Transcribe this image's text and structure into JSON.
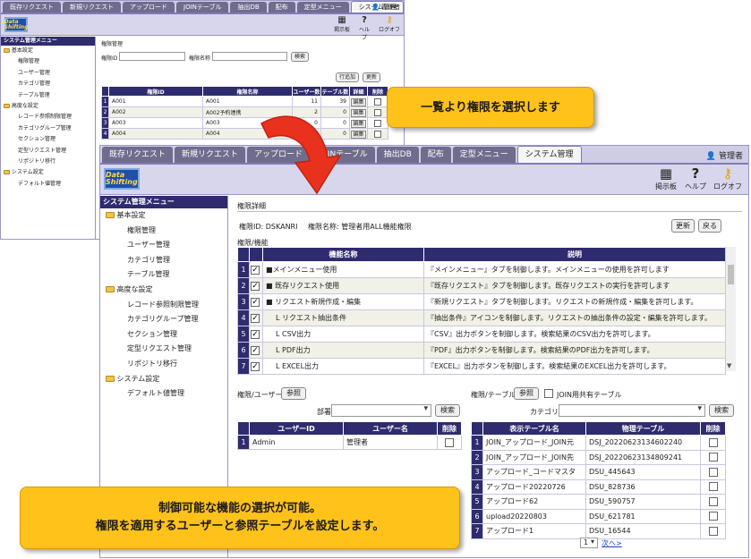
{
  "back": {
    "tabs": [
      "既存リクエスト",
      "新規リクエスト",
      "アップロード",
      "JOINテーブル",
      "抽出DB",
      "配布",
      "定型メニュー",
      "システム管理"
    ],
    "user": "管理者",
    "toolbar": {
      "board": "掲示板",
      "help": "ヘルプ",
      "logout": "ログオフ",
      "logo": "Data Shifting"
    },
    "sidebar": {
      "title": "システム管理メニュー",
      "g1": "基本設定",
      "g1_items": [
        "権限管理",
        "ユーザー管理",
        "カテゴリ管理",
        "テーブル管理"
      ],
      "g2": "高度な設定",
      "g2_items": [
        "レコード参照制限管理",
        "カテゴリグループ管理",
        "セクション管理",
        "定型リクエスト管理",
        "リポジトリ移行"
      ],
      "g3": "システム設定",
      "g3_items": [
        "デフォルト値管理"
      ]
    },
    "page_title": "権限管理",
    "search_id_label": "権限ID",
    "search_name_label": "権限名称",
    "search_btn": "検索",
    "add_btn": "行追加",
    "update_btn": "更新",
    "columns": [
      "権限ID",
      "権限名称",
      "ユーザー数",
      "テーブル数",
      "詳細",
      "削除"
    ],
    "rows": [
      {
        "n": "1",
        "id": "A001",
        "name": "A001",
        "users": "11",
        "tables": "39",
        "detail": "編集"
      },
      {
        "n": "2",
        "id": "A002",
        "name": "A002予約連携",
        "users": "2",
        "tables": "0",
        "detail": "編集"
      },
      {
        "n": "3",
        "id": "A003",
        "name": "A003",
        "users": "0",
        "tables": "0",
        "detail": "編集"
      },
      {
        "n": "4",
        "id": "A004",
        "name": "A004",
        "users": "0",
        "tables": "0",
        "detail": "編集"
      }
    ]
  },
  "front": {
    "tabs": [
      "既存リクエスト",
      "新規リクエスト",
      "アップロード",
      "JOINテーブル",
      "抽出DB",
      "配布",
      "定型メニュー",
      "システム管理"
    ],
    "user": "管理者",
    "toolbar": {
      "board": "掲示板",
      "help": "ヘルプ",
      "logout": "ログオフ",
      "logo": "Data Shifting"
    },
    "sidebar": {
      "title": "システム管理メニュー",
      "g1": "基本設定",
      "g1_items": [
        "権限管理",
        "ユーザー管理",
        "カテゴリ管理",
        "テーブル管理"
      ],
      "g2": "高度な設定",
      "g2_items": [
        "レコード参照制限管理",
        "カテゴリグループ管理",
        "セクション管理",
        "定型リクエスト管理",
        "リポジトリ移行"
      ],
      "g3": "システム設定",
      "g3_items": [
        "デフォルト値管理"
      ]
    },
    "page_title": "権限詳細",
    "id_line": "権限ID: DSKANRI",
    "name_line": "権限名称: 管理者用ALL機能権限",
    "update_btn": "更新",
    "back_btn": "戻る",
    "func_section": "権限/機能",
    "func_columns": [
      "機能名称",
      "説明"
    ],
    "func_rows": [
      {
        "n": "1",
        "name": "■メインメニュー使用",
        "desc": "『メインメニュー』タブを制御します。メインメニューの使用を許可します"
      },
      {
        "n": "2",
        "name": "■ 既存リクエスト使用",
        "desc": "『既存リクエスト』タブを制御します。既存リクエストの実行を許可します"
      },
      {
        "n": "3",
        "name": "■ リクエスト新規作成・編集",
        "desc": "『新規リクエスト』タブを制御します。リクエストの新規作成・編集を許可します。"
      },
      {
        "n": "4",
        "name": "L リクエスト抽出条件",
        "desc": "『抽出条件』アイコンを制御します。リクエストの抽出条件の設定・編集を許可します。"
      },
      {
        "n": "5",
        "name": "L CSV出力",
        "desc": "『CSV』出力ボタンを制御します。検索結果のCSV出力を許可します。"
      },
      {
        "n": "6",
        "name": "L PDF出力",
        "desc": "『PDF』出力ボタンを制御します。検索結果のPDF出力を許可します。"
      },
      {
        "n": "7",
        "name": "L EXCEL出力",
        "desc": "『EXCEL』出力ボタンを制御します。検索結果のEXCEL出力を許可します。"
      }
    ],
    "user_section": "権限/ユーザー",
    "ref_btn": "参照",
    "dept_label": "部署",
    "search_btn": "検索",
    "user_columns": [
      "ユーザーID",
      "ユーザー名",
      "削除"
    ],
    "user_rows": [
      {
        "n": "1",
        "id": "Admin",
        "name": "管理者"
      }
    ],
    "table_section": "権限/テーブル",
    "join_label": "JOIN用共有テーブル",
    "category_label": "カテゴリ名",
    "table_columns": [
      "表示テーブル名",
      "物理テーブル",
      "削除"
    ],
    "table_rows": [
      {
        "n": "1",
        "disp": "JOIN_アップロード_JOIN元",
        "phys": "DSJ_20220623134602240"
      },
      {
        "n": "2",
        "disp": "JOIN_アップロード_JOIN先",
        "phys": "DSJ_20220623134809241"
      },
      {
        "n": "3",
        "disp": "アップロード_コードマスタ",
        "phys": "DSU_445643"
      },
      {
        "n": "4",
        "disp": "アップロード20220726",
        "phys": "DSU_828736"
      },
      {
        "n": "5",
        "disp": "アップロード62",
        "phys": "DSU_590757"
      },
      {
        "n": "6",
        "disp": "upload20220803",
        "phys": "DSU_621781"
      },
      {
        "n": "7",
        "disp": "アップロード1",
        "phys": "DSU_16544"
      }
    ],
    "pager_value": "1",
    "next_link": "次へ>"
  },
  "callout_top": "一覧より権限を選択します",
  "callout_bottom_line1": "制御可能な機能の選択が可能。",
  "callout_bottom_line2": "権限を適用するユーザーと参照テーブルを設定します。",
  "colors": {
    "header": "#2f2b6f",
    "tabbar": "#cfcde6",
    "tab": "#6f6c8e",
    "callout": "#ffc21a",
    "arrow": "#e8321e"
  }
}
